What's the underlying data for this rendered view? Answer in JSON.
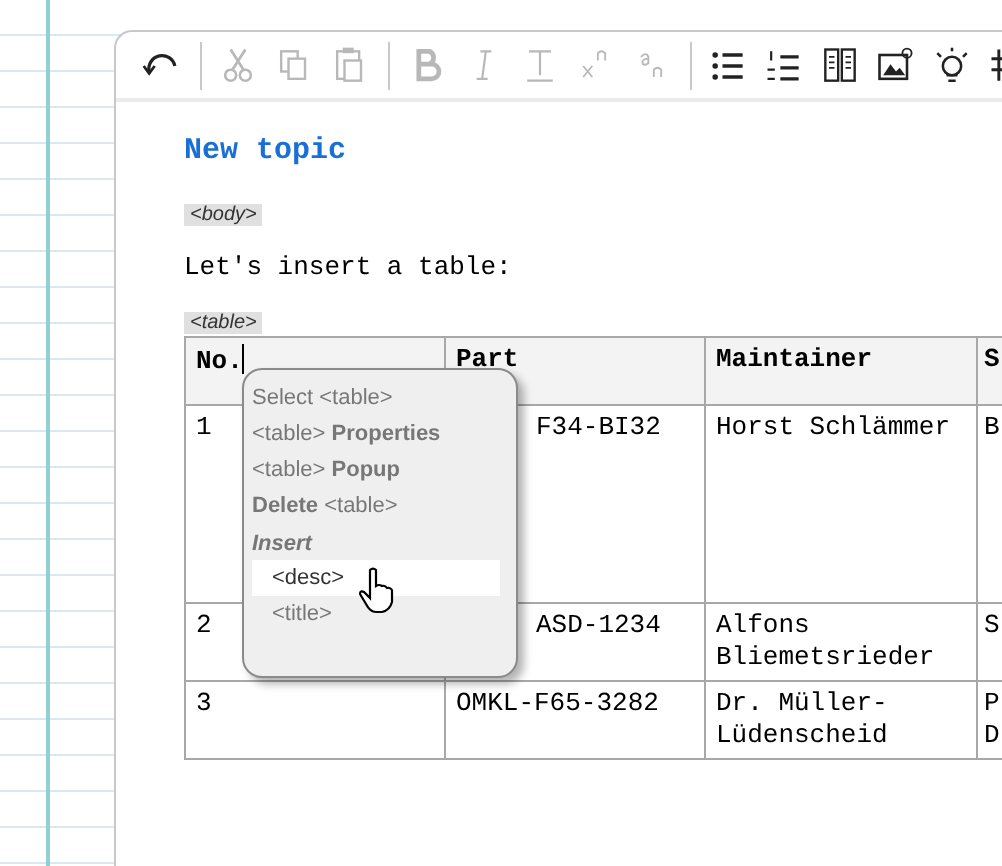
{
  "toolbar": {
    "groups": [
      [
        {
          "disabled": false
        }
      ],
      [
        {
          "disabled": true
        },
        {
          "disabled": true
        },
        {
          "disabled": true
        }
      ],
      [
        {
          "disabled": true
        },
        {
          "disabled": true
        },
        {
          "disabled": true
        },
        {
          "disabled": true
        },
        {
          "disabled": true
        }
      ],
      [
        {
          "disabled": false
        },
        {
          "disabled": false
        },
        {
          "disabled": false
        },
        {
          "disabled": false
        },
        {
          "disabled": false
        },
        {
          "disabled": false
        }
      ]
    ]
  },
  "document": {
    "title": "New topic",
    "body_tag": "<body>",
    "paragraph": "Let's insert a table:",
    "table_tag": "<table>",
    "table": {
      "columns": [
        {
          "label": "No.",
          "caret": true
        },
        {
          "label": "Part"
        },
        {
          "label": "Maintainer"
        },
        {
          "label": "S"
        }
      ],
      "rows": [
        [
          {
            "text": "1"
          },
          {
            "text": "F34-BI32",
            "covered": true
          },
          {
            "text": "Horst Schlämmer"
          },
          {
            "text": "B"
          }
        ],
        [
          {
            "text": "2"
          },
          {
            "text": "ASD-1234",
            "covered": true
          },
          {
            "text": "Alfons Bliemetsrieder"
          },
          {
            "text": "S"
          }
        ],
        [
          {
            "text": "3"
          },
          {
            "text": "OMKL-F65-3282"
          },
          {
            "text": "Dr. Müller-Lüdenscheid"
          },
          {
            "text": "P D"
          }
        ]
      ]
    }
  },
  "context_menu": {
    "items": [
      {
        "kind": "command",
        "text": "Select <table>",
        "selected": false
      },
      {
        "kind": "command",
        "text": "<table> **Properties**",
        "selected": false
      },
      {
        "kind": "command",
        "text": "<table> **Popup**",
        "selected": false
      },
      {
        "kind": "command",
        "text": "**Delete** <table>",
        "selected": false
      },
      {
        "kind": "heading",
        "text": "**Insert**"
      },
      {
        "kind": "insert",
        "text": "<desc>",
        "selected": true
      },
      {
        "kind": "insert",
        "text": "<title>",
        "selected": false
      }
    ]
  }
}
